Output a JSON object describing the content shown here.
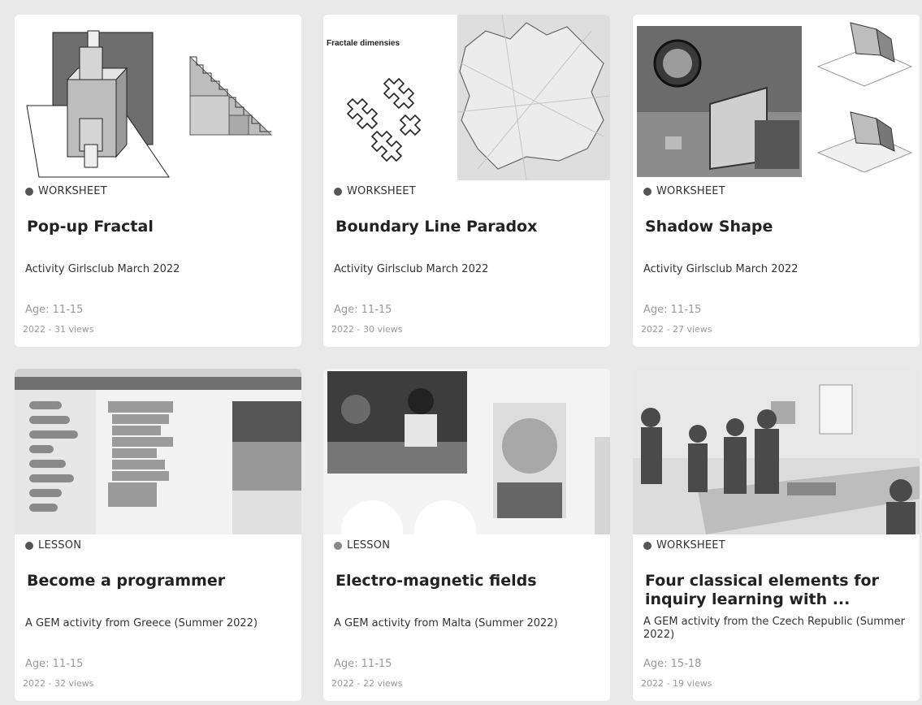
{
  "cards": [
    {
      "type": "WORKSHEET",
      "title": "Pop-up Fractal",
      "subtitle": "Activity Girlsclub March 2022",
      "age": "Age: 11-15",
      "meta": "2022 - 31 views",
      "thumb": "popup-fractal-image"
    },
    {
      "type": "WORKSHEET",
      "title": "Boundary Line Paradox",
      "subtitle": "Activity Girlsclub March 2022",
      "age": "Age: 11-15",
      "meta": "2022 - 30 views",
      "thumb": "fractal-dimension-map-image",
      "thumb_caption": "Fractale dimensies"
    },
    {
      "type": "WORKSHEET",
      "title": "Shadow Shape",
      "subtitle": "Activity Girlsclub March 2022",
      "age": "Age: 11-15",
      "meta": "2022 - 27 views",
      "thumb": "shadow-experiment-image"
    },
    {
      "type": "LESSON",
      "title": "Become a programmer",
      "subtitle": "A GEM activity from Greece (Summer 2022)",
      "age": "Age: 11-15",
      "meta": "2022 - 32 views",
      "thumb": "scratch-screenshot-image"
    },
    {
      "type": "LESSON",
      "title": "Electro-magnetic fields",
      "subtitle": "A GEM activity from Malta (Summer 2022)",
      "age": "Age: 11-15",
      "meta": "2022 - 22 views",
      "thumb": "children-photos-image"
    },
    {
      "type": "WORKSHEET",
      "title": "Four classical elements for inquiry learning with ...",
      "subtitle": "A GEM activity from the Czech Republic (Summer 2022)",
      "age": "Age: 15-18",
      "meta": "2022 - 19 views",
      "thumb": "classroom-photo-image"
    }
  ],
  "colors": {
    "background": "#e9e9e9",
    "card": "#ffffff",
    "dot": "#555555",
    "muted": "#9a9a9a"
  }
}
